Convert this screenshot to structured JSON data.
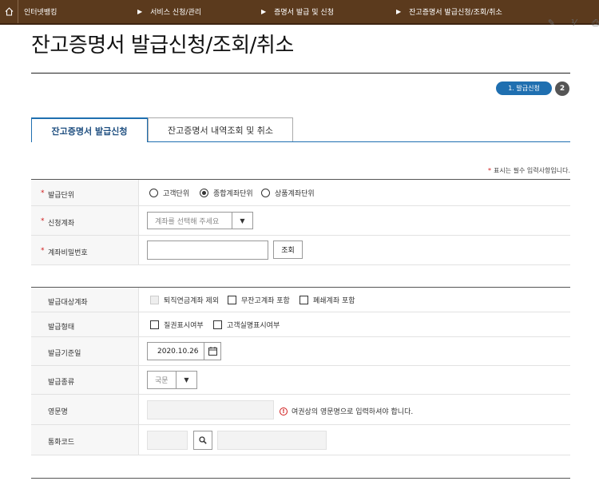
{
  "nav": {
    "items": [
      "인터넷뱅킹",
      "서비스 신청/관리",
      "증명서 발급 및 신청",
      "잔고증명서 발급신청/조회/취소"
    ]
  },
  "page": {
    "title": "잔고증명서 발급신청/조회/취소"
  },
  "steps": {
    "active": "1. 발급신청",
    "next": "2"
  },
  "tabs": {
    "active": "잔고증명서 발급신청",
    "inactive": "잔고증명서 내역조회 및 취소"
  },
  "required_note": "표시는 필수 입력사항입니다.",
  "form": {
    "unit": {
      "label": "발급단위",
      "options": [
        "고객단위",
        "종합계좌단위",
        "상품계좌단위"
      ],
      "selected": "종합계좌단위"
    },
    "account": {
      "label": "신청계좌",
      "placeholder": "계좌를 선택해 주세요"
    },
    "password": {
      "label": "계좌비밀번호",
      "button": "조회"
    },
    "target": {
      "label": "발급대상계좌",
      "options": [
        "퇴직연금계좌 제외",
        "무잔고계좌 포함",
        "폐쇄계좌 포함"
      ]
    },
    "form_type": {
      "label": "발급형태",
      "options": [
        "질권표시여부",
        "고객실명표시여부"
      ]
    },
    "base_date": {
      "label": "발급기준일",
      "value": "2020.10.26"
    },
    "kind": {
      "label": "발급종류",
      "value": "국문"
    },
    "eng_name": {
      "label": "영문명",
      "warning": "여권상의 영문명으로 입력하셔야 합니다."
    },
    "currency": {
      "label": "통화코드"
    }
  }
}
